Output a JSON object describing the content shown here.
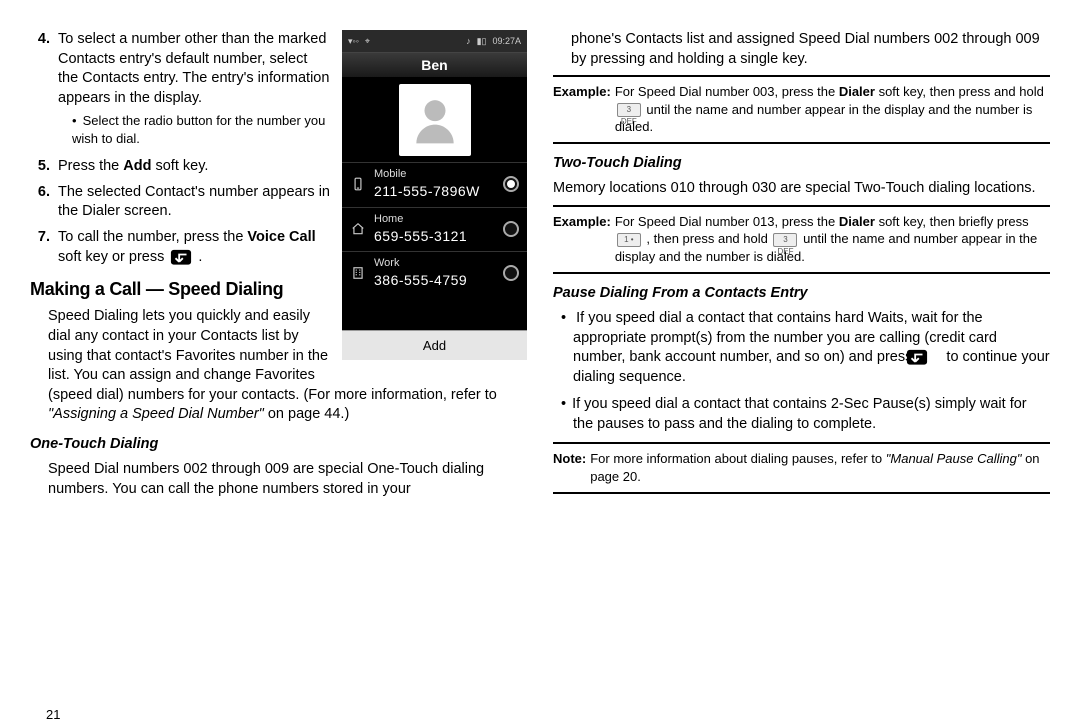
{
  "page_number": "21",
  "phone": {
    "status_time": "09:27A",
    "contact_name": "Ben",
    "rows": [
      {
        "label": "Mobile",
        "number": "211-555-7896W",
        "selected": true
      },
      {
        "label": "Home",
        "number": "659-555-3121",
        "selected": false
      },
      {
        "label": "Work",
        "number": "386-555-4759",
        "selected": false
      }
    ],
    "softkey": "Add"
  },
  "left": {
    "step4": "To select a number other than the marked Contacts entry's default number, select the Contacts entry. The entry's information appears in the display.",
    "step4_bullet": "Select the radio button for the number you wish to dial.",
    "step5_pre": "Press the ",
    "step5_bold": "Add",
    "step5_post": " soft key.",
    "step6": "The selected Contact's number appears in the Dialer screen.",
    "step7_pre": "To call the number, press the ",
    "step7_bold": "Voice Call",
    "step7_post": " soft key or press ",
    "h1": "Making a Call — Speed Dialing",
    "speed_para_a": "Speed Dialing lets you quickly and easily dial any contact in your Contacts list by using that contact's Favorites number in the list. You can assign and change Favorites (speed dial) numbers for your contacts. (For more information, refer to ",
    "speed_para_ital": "\"Assigning a Speed Dial Number\"",
    "speed_para_b": "  on page 44.)",
    "h2_one": "One-Touch Dialing",
    "one_touch": "Speed Dial numbers 002 through 009 are special One-Touch dialing numbers. You can call the phone numbers stored in your"
  },
  "right": {
    "cont": "phone's Contacts list and assigned Speed Dial numbers 002 through 009 by pressing and holding a single key.",
    "ex1_tag": "Example:",
    "ex1_a": "For Speed Dial number 003, press the ",
    "ex1_bold": "Dialer",
    "ex1_b": " soft key, then press and hold ",
    "ex1_c": " until the name and number appear in the display and the number is dialed.",
    "key3": "3 DEF",
    "h2_two": "Two-Touch Dialing",
    "two_touch": "Memory locations 010 through 030 are special Two-Touch dialing locations.",
    "ex2_tag": "Example:",
    "ex2_a": "For Speed Dial number 013, press the ",
    "ex2_bold": "Dialer",
    "ex2_b": " soft key, then briefly press ",
    "key1": "1 •",
    "ex2_c": " , then press and hold ",
    "ex2_d": " until the name and number appear in the display and the number is dialed.",
    "h2_pause": "Pause Dialing From a Contacts Entry",
    "pause_b1_a": "If you speed dial a contact that contains hard Waits, wait for the appropriate prompt(s) from the number you are calling (credit card number, bank account number, and so on) and press ",
    "pause_b1_b": "  to continue your dialing sequence.",
    "pause_b2": "If you speed dial a contact that contains 2-Sec Pause(s) simply wait for the pauses to pass and the dialing to complete.",
    "note_tag": "Note:",
    "note_a": "For more information about dialing pauses, refer to ",
    "note_ital": "\"Manual Pause Calling\"",
    "note_b": " on page 20."
  }
}
